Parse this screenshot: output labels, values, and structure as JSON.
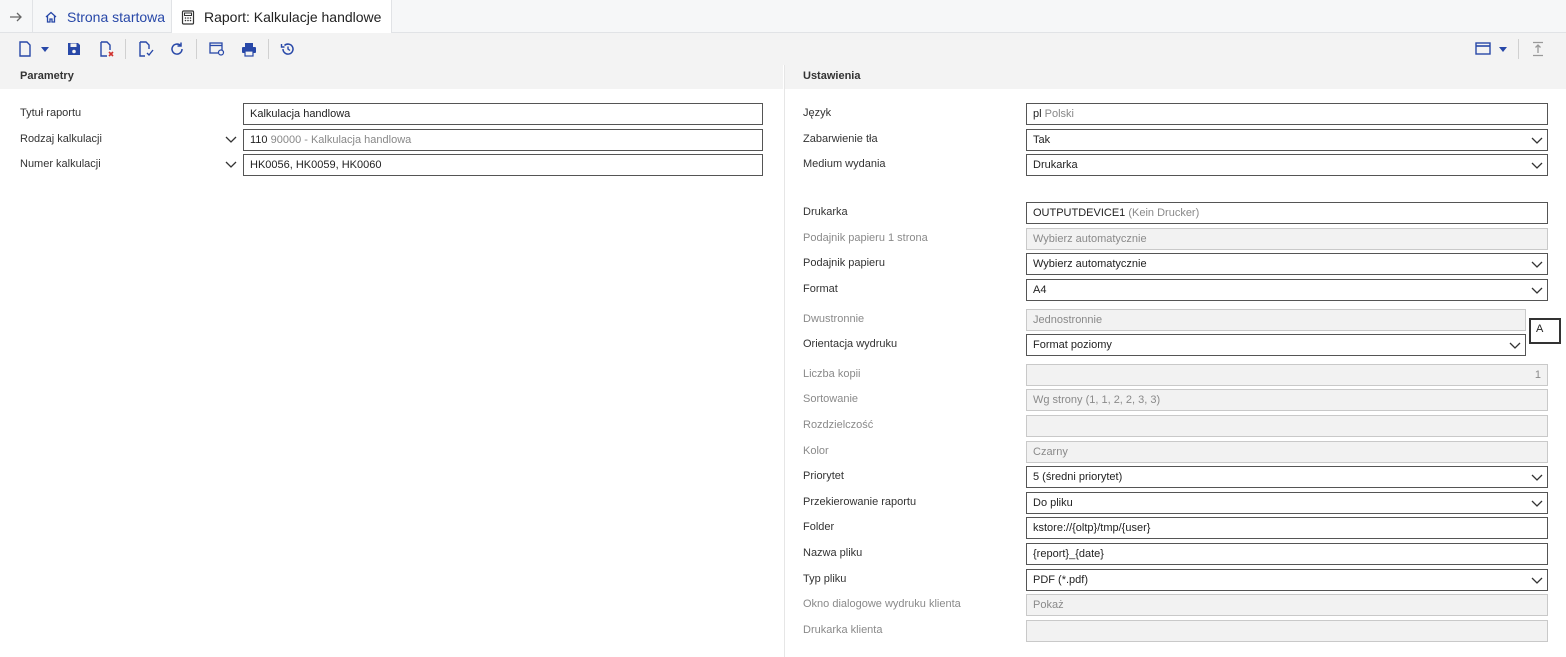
{
  "tabs": {
    "home_label": "Strona startowa",
    "active_label": "Raport: Kalkulacje handlowe"
  },
  "icons": {
    "back": "arrow-right-icon",
    "home": "home-icon",
    "report": "calculator-icon"
  },
  "colors": {
    "accent": "#2848a8",
    "toolbar_bg": "#f3f3f3"
  },
  "parameters": {
    "section_title": "Parametry",
    "title_label": "Tytuł raportu",
    "title_value": "Kalkulacja handlowa",
    "kind_label": "Rodzaj kalkulacji",
    "kind_code": "110",
    "kind_desc": "90000 - Kalkulacja handlowa",
    "number_label": "Numer kalkulacji",
    "number_value": "HK0056, HK0059, HK0060"
  },
  "settings": {
    "section_title": "Ustawienia",
    "language_label": "Język",
    "language_code": "pl",
    "language_name": "Polski",
    "bg_label": "Zabarwienie tła",
    "bg_value": "Tak",
    "medium_label": "Medium wydania",
    "medium_value": "Drukarka",
    "printer_label": "Drukarka",
    "printer_value": "OUTPUTDEVICE1",
    "printer_desc": "(Kein Drucker)",
    "tray1_label": "Podajnik papieru 1 strona",
    "tray1_value": "Wybierz automatycznie",
    "tray_label": "Podajnik papieru",
    "tray_value": "Wybierz automatycznie",
    "format_label": "Format",
    "format_value": "A4",
    "duplex_label": "Dwustronnie",
    "duplex_value": "Jednostronnie",
    "duplex_badge": "A",
    "orientation_label": "Orientacja wydruku",
    "orientation_value": "Format poziomy",
    "copies_label": "Liczba kopii",
    "copies_value": "1",
    "sorting_label": "Sortowanie",
    "sorting_value": "Wg strony (1, 1, 2, 2, 3, 3)",
    "resolution_label": "Rozdzielczość",
    "resolution_value": "",
    "color_label": "Kolor",
    "color_value": "Czarny",
    "priority_label": "Priorytet",
    "priority_value": "5 (średni priorytet)",
    "redirect_label": "Przekierowanie raportu",
    "redirect_value": "Do pliku",
    "folder_label": "Folder",
    "folder_value": "kstore://{oltp}/tmp/{user}",
    "filename_label": "Nazwa pliku",
    "filename_value": "{report}_{date}",
    "filetype_label": "Typ pliku",
    "filetype_value": "PDF (*.pdf)",
    "client_dialog_label": "Okno dialogowe wydruku klienta",
    "client_dialog_value": "Pokaż",
    "client_printer_label": "Drukarka klienta",
    "client_printer_value": ""
  }
}
